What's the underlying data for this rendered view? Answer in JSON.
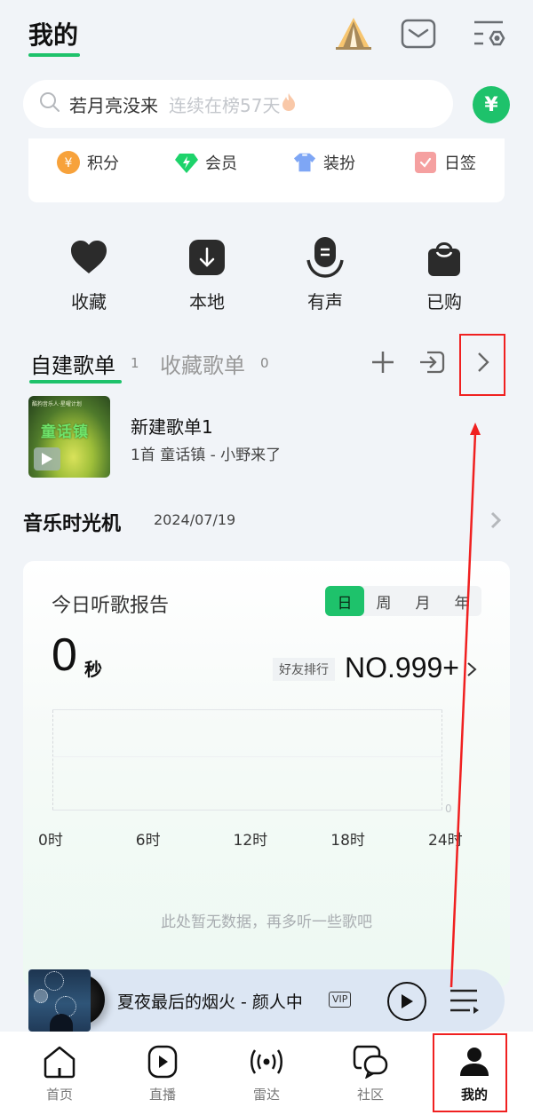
{
  "header": {
    "title": "我的",
    "icons": [
      "camp-tent-icon",
      "mail-icon",
      "settings-menu-icon"
    ]
  },
  "search": {
    "query": "若月亮没来",
    "hint": "连续在榜57天",
    "hint_icon": "fire-icon",
    "yen_button": "¥"
  },
  "quick_links": [
    {
      "label": "积分",
      "icon": "points-coin-icon",
      "color": "#f7a23b"
    },
    {
      "label": "会员",
      "icon": "vip-diamond-icon",
      "color": "#1ed36b"
    },
    {
      "label": "装扮",
      "icon": "tshirt-icon",
      "color": "#7ea6f5"
    },
    {
      "label": "日签",
      "icon": "daily-checkin-icon",
      "color": "#f5a0a0"
    }
  ],
  "shortcuts": [
    {
      "label": "收藏",
      "icon": "heart-icon"
    },
    {
      "label": "本地",
      "icon": "download-icon"
    },
    {
      "label": "有声",
      "icon": "audiobook-icon"
    },
    {
      "label": "已购",
      "icon": "shopping-bag-icon"
    }
  ],
  "playlist_tabs": {
    "active": {
      "label": "自建歌单",
      "count": "1"
    },
    "inactive": {
      "label": "收藏歌单",
      "count": "0"
    },
    "actions": [
      "add-icon",
      "import-icon",
      "chevron-right-icon"
    ]
  },
  "playlists": [
    {
      "name": "新建歌单1",
      "subtitle": "1首 童话镇 - 小野来了",
      "cover_title": "童话镇",
      "cover_caption": "酷狗音乐人·星曜计划"
    }
  ],
  "time_machine": {
    "title": "音乐时光机",
    "date": "2024/07/19"
  },
  "report": {
    "title": "今日听歌报告",
    "periods": [
      "日",
      "周",
      "月",
      "年"
    ],
    "selected_period": "日",
    "listen_value": "0",
    "listen_unit": "秒",
    "friend_rank_label": "好友排行",
    "friend_rank": "NO.999+",
    "empty_message": "此处暂无数据，再多听一些歌吧"
  },
  "chart_data": {
    "type": "line",
    "title": "",
    "x": [
      0,
      6,
      12,
      18,
      24
    ],
    "xtick_labels": [
      "0时",
      "6时",
      "12时",
      "18时",
      "24时"
    ],
    "series": [],
    "ytick_labels": [
      "0"
    ],
    "xlabel": "",
    "ylabel": "",
    "grid": true,
    "empty": true
  },
  "player": {
    "song": "夏夜最后的烟火 - 颜人中",
    "badge": "VIP"
  },
  "bottom_nav": [
    {
      "label": "首页",
      "icon": "home-icon",
      "active": false
    },
    {
      "label": "直播",
      "icon": "live-play-icon",
      "active": false
    },
    {
      "label": "雷达",
      "icon": "radar-icon",
      "active": false
    },
    {
      "label": "社区",
      "icon": "community-chat-icon",
      "active": false
    },
    {
      "label": "我的",
      "icon": "profile-icon",
      "active": true
    }
  ],
  "colors": {
    "accent": "#1ec26b",
    "annotation": "#f02020",
    "background": "#f1f4f8"
  }
}
